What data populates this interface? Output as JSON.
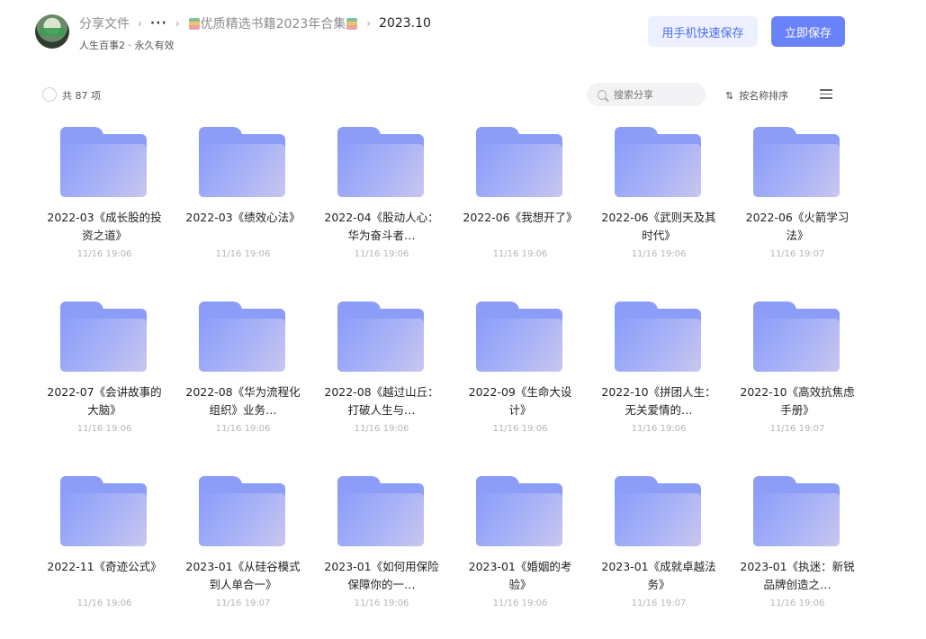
{
  "breadcrumb": {
    "root": "分享文件",
    "more": "···",
    "collection": "优质精选书籍2023年合集",
    "current": "2023.10"
  },
  "share_info": {
    "owner": "人生百事2",
    "separator": " · ",
    "validity": "永久有效"
  },
  "header_buttons": {
    "mobile_save": "用手机快速保存",
    "save_now": "立即保存"
  },
  "toolbar": {
    "count": "共 87 项",
    "search_placeholder": "搜索分享",
    "sort_label": "按名称排序"
  },
  "colors": {
    "accent": "#6a82f8",
    "folder": "#8c9df8",
    "mobile_btn_bg": "#edf1ff"
  },
  "files": [
    {
      "name": "2022-03《成长股的投资之道》",
      "date": "11/16 19:06"
    },
    {
      "name": "2022-03《绩效心法》",
      "date": "11/16 19:06"
    },
    {
      "name": "2022-04《股动人心：华为奋斗者…",
      "date": "11/16 19:06"
    },
    {
      "name": "2022-06《我想开了》",
      "date": "11/16 19:06"
    },
    {
      "name": "2022-06《武则天及其时代》",
      "date": "11/16 19:06"
    },
    {
      "name": "2022-06《火箭学习法》",
      "date": "11/16 19:07"
    },
    {
      "name": "2022-07《会讲故事的大脑》",
      "date": "11/16 19:06"
    },
    {
      "name": "2022-08《华为流程化组织》业务…",
      "date": "11/16 19:06"
    },
    {
      "name": "2022-08《越过山丘：打破人生与…",
      "date": "11/16 19:06"
    },
    {
      "name": "2022-09《生命大设计》",
      "date": "11/16 19:06"
    },
    {
      "name": "2022-10《拼团人生：无关爱情的…",
      "date": "11/16 19:06"
    },
    {
      "name": "2022-10《高效抗焦虑手册》",
      "date": "11/16 19:07"
    },
    {
      "name": "2022-11《奇迹公式》",
      "date": "11/16 19:06"
    },
    {
      "name": "2023-01《从硅谷模式到人单合一》",
      "date": "11/16 19:07"
    },
    {
      "name": "2023-01《如何用保险保障你的一…",
      "date": "11/16 19:06"
    },
    {
      "name": "2023-01《婚姻的考验》",
      "date": "11/16 19:06"
    },
    {
      "name": "2023-01《成就卓越法务》",
      "date": "11/16 19:07"
    },
    {
      "name": "2023-01《执迷：新锐品牌创造之…",
      "date": "11/16 19:06"
    }
  ]
}
